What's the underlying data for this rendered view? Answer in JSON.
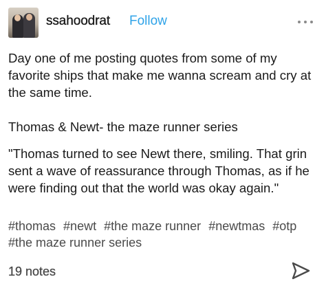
{
  "post": {
    "username": "ssahoodrat",
    "follow_label": "Follow",
    "paragraphs": [
      "Day one of me posting quotes from some of my favorite ships that make me wanna scream and cry at the same time.",
      "Thomas & Newt- the maze runner series",
      "\"Thomas turned to see Newt there, smiling. That grin sent a wave of reassurance through Thomas, as if he were finding out that the world was okay again.\""
    ],
    "tags": [
      "#thomas",
      "#newt",
      "#the maze runner",
      "#newtmas",
      "#otp",
      "#the maze runner series"
    ],
    "notes": "19 notes"
  },
  "icons": {
    "more": "ellipsis-icon",
    "share": "send-arrow-icon",
    "avatar": "avatar-image"
  },
  "colors": {
    "follow": "#2fa3e8",
    "text": "#1a1a1a",
    "secondary_text": "#4a4a4a",
    "icon": "#8a8a8a"
  }
}
